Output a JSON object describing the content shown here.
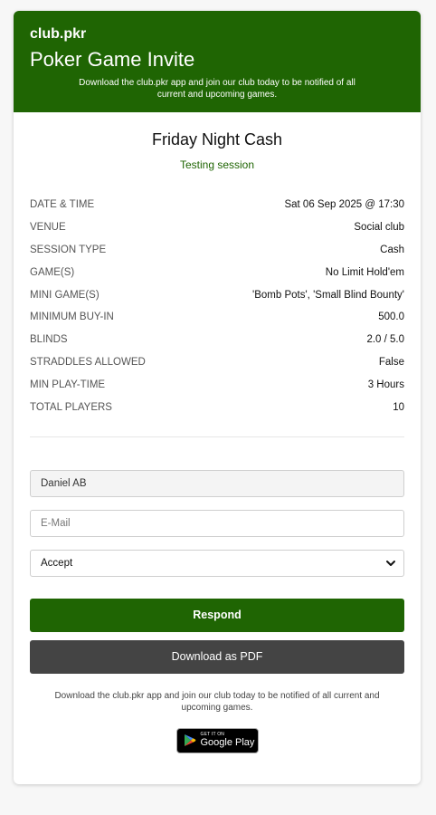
{
  "header": {
    "brand": "club.pkr",
    "title": "Poker Game Invite",
    "subtitle": "Download the club.pkr app and join our club today to be notified of all current and upcoming games."
  },
  "session": {
    "name": "Friday Night Cash",
    "note": "Testing session"
  },
  "details": [
    {
      "label": "DATE & TIME",
      "value": "Sat 06 Sep 2025 @ 17:30"
    },
    {
      "label": "VENUE",
      "value": "Social club"
    },
    {
      "label": "SESSION TYPE",
      "value": "Cash"
    },
    {
      "label": "GAME(S)",
      "value": "No Limit Hold'em"
    },
    {
      "label": "MINI GAME(S)",
      "value": "'Bomb Pots', 'Small Blind Bounty'"
    },
    {
      "label": "MINIMUM BUY-IN",
      "value": "500.0"
    },
    {
      "label": "BLINDS",
      "value": "2.0 / 5.0"
    },
    {
      "label": "STRADDLES ALLOWED",
      "value": "False"
    },
    {
      "label": "MIN PLAY-TIME",
      "value": "3 Hours"
    },
    {
      "label": "TOTAL PLAYERS",
      "value": "10"
    }
  ],
  "form": {
    "name_value": "Daniel AB",
    "email_placeholder": "E-Mail",
    "response_selected": "Accept",
    "respond_label": "Respond",
    "pdf_label": "Download as PDF"
  },
  "footer": {
    "text": "Download the club.pkr app and join our club today to be notified of all current and upcoming games.",
    "store_top": "GET IT ON",
    "store_main": "Google Play"
  },
  "colors": {
    "brand_green": "#1f6503",
    "pdf_button": "#444444"
  },
  "icons": {
    "select": "chevron-down-icon",
    "store": "google-play-icon"
  }
}
